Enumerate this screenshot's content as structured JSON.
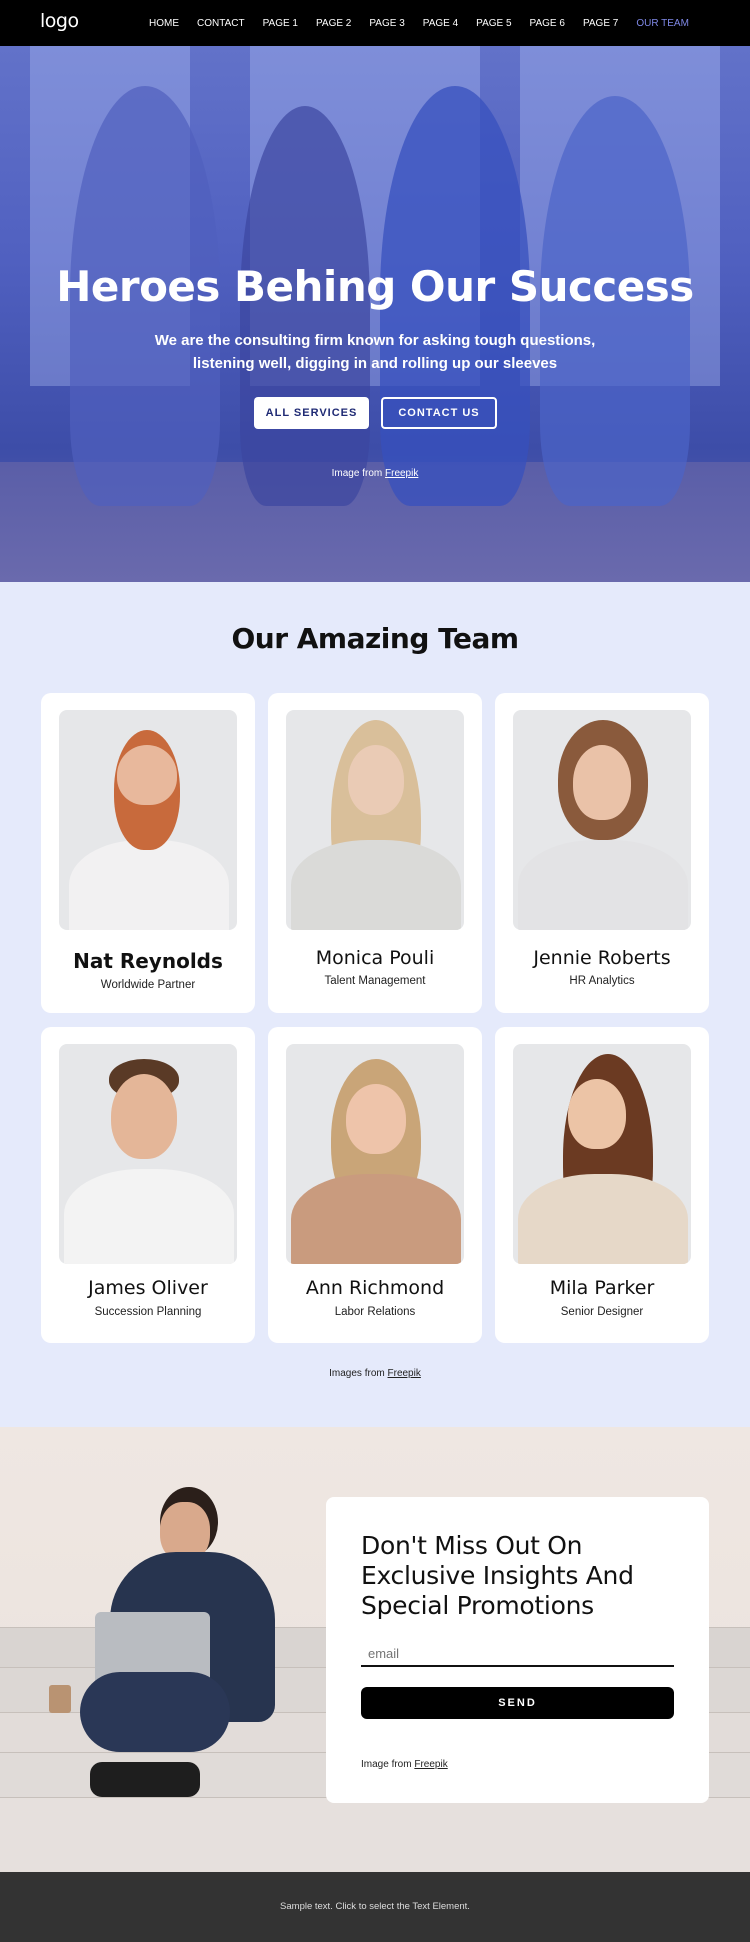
{
  "nav": {
    "logo": "logo",
    "items": [
      {
        "label": "HOME",
        "active": false
      },
      {
        "label": "CONTACT",
        "active": false
      },
      {
        "label": "PAGE 1",
        "active": false
      },
      {
        "label": "PAGE 2",
        "active": false
      },
      {
        "label": "PAGE 3",
        "active": false
      },
      {
        "label": "PAGE 4",
        "active": false
      },
      {
        "label": "PAGE 5",
        "active": false
      },
      {
        "label": "PAGE 6",
        "active": false
      },
      {
        "label": "PAGE 7",
        "active": false
      },
      {
        "label": "OUR TEAM",
        "active": true
      }
    ],
    "active_color": "#7f88e6"
  },
  "hero": {
    "title": "Heroes Behing Our Success",
    "subtitle": "We are the consulting firm known for asking tough questions, listening well, digging in and rolling up our sleeves",
    "primary_button": "ALL SERVICES",
    "secondary_button": "CONTACT US",
    "credit_prefix": "Image from ",
    "credit_link": "Freepik",
    "overlay_color": "#4a5bc0"
  },
  "team": {
    "title": "Our Amazing Team",
    "members": [
      {
        "name": "Nat Reynolds",
        "role": "Worldwide Partner"
      },
      {
        "name": "Monica Pouli",
        "role": "Talent Management"
      },
      {
        "name": "Jennie Roberts",
        "role": "HR Analytics"
      },
      {
        "name": "James Oliver",
        "role": "Succession Planning"
      },
      {
        "name": "Ann Richmond",
        "role": "Labor Relations"
      },
      {
        "name": "Mila Parker",
        "role": "Senior Designer"
      }
    ],
    "credit_prefix": "Images from ",
    "credit_link": "Freepik"
  },
  "promo": {
    "title": "Don't Miss Out On Exclusive Insights And Special Promotions",
    "email_placeholder": "email",
    "send_label": "SEND",
    "credit_prefix": "Image from ",
    "credit_link": "Freepik"
  },
  "footer": {
    "text": "Sample text. Click to select the Text Element."
  }
}
